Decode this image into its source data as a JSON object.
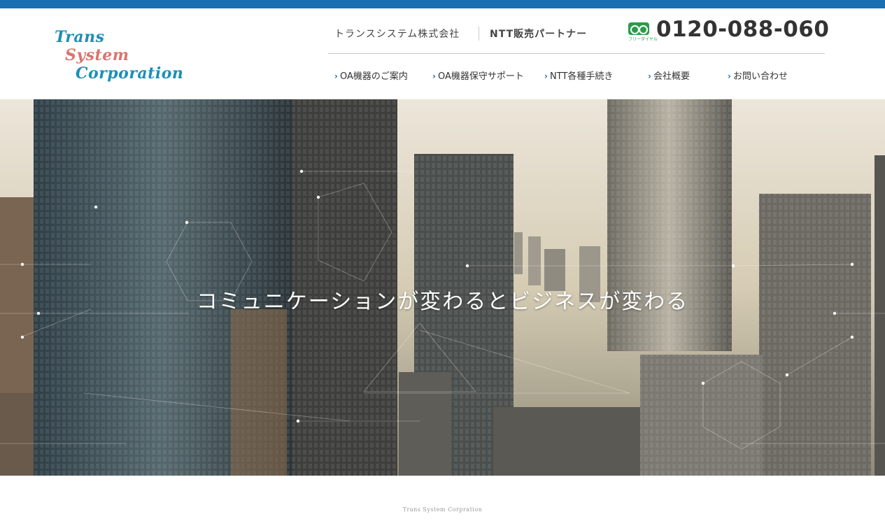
{
  "logo": {
    "line1": "Trans",
    "line2": "System",
    "line3": "Corporation"
  },
  "header": {
    "company_name": "トランスシステム株式会社",
    "partner_text": "NTT販売パートナー",
    "freedial_label": "フリーダイヤル",
    "phone": "0120-088-060"
  },
  "nav": {
    "items": [
      {
        "label": "OA機器のご案内"
      },
      {
        "label": "OA機器保守サポート"
      },
      {
        "label": "NTT各種手続き"
      },
      {
        "label": "会社概要"
      },
      {
        "label": "お問い合わせ"
      }
    ]
  },
  "hero": {
    "tagline": "コミュニケーションが変わるとビジネスが変わる"
  },
  "footer": {
    "label": "Trans System Corpration"
  },
  "colors": {
    "accent_blue": "#1a6fb3",
    "logo_blue": "#1c8fb8",
    "logo_pink": "#d9756e",
    "freedial_green": "#2c9a4a"
  }
}
